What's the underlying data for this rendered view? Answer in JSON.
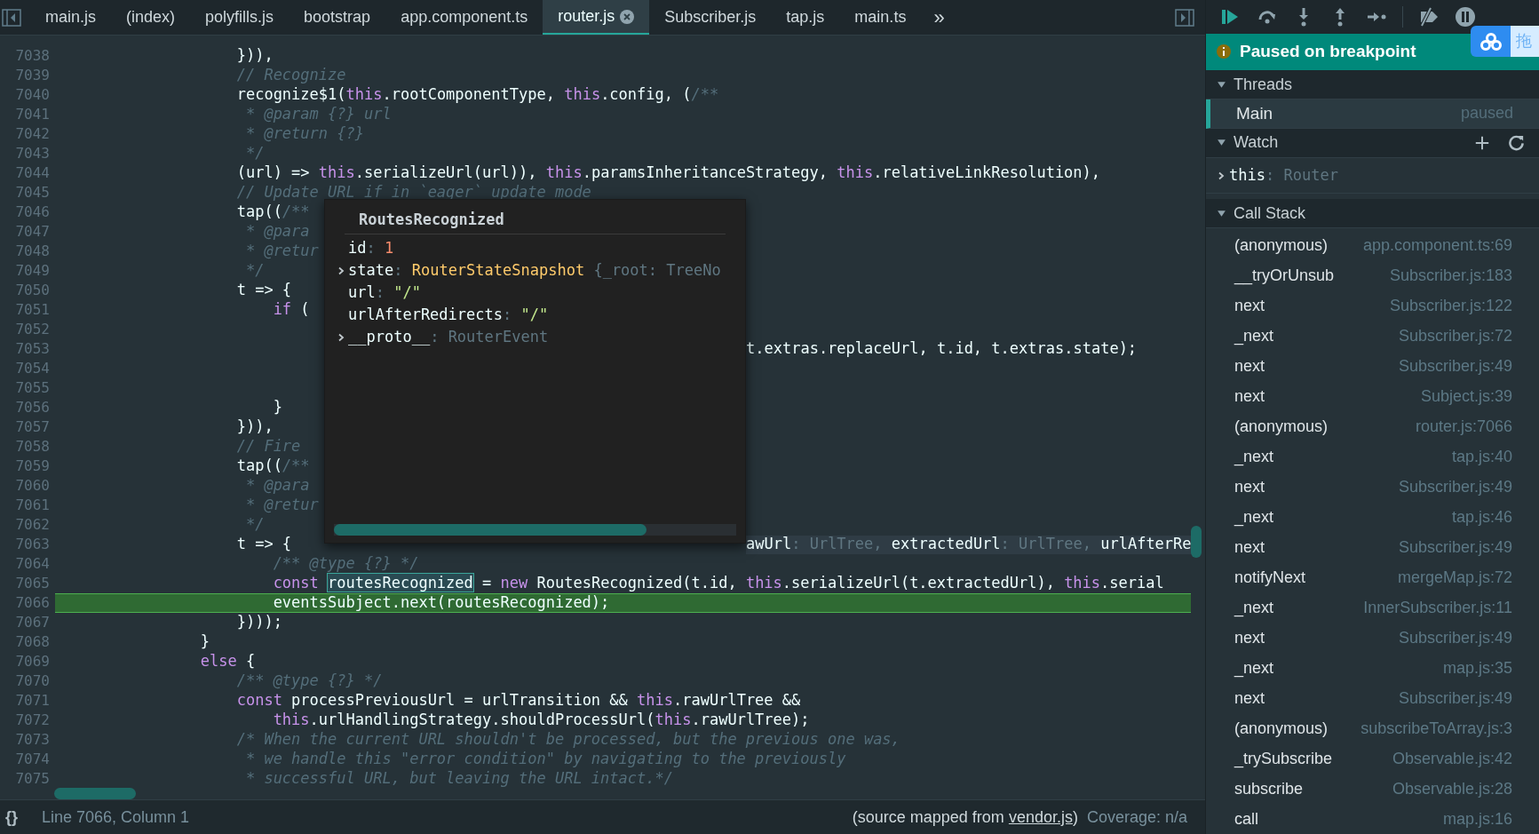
{
  "tabs": [
    {
      "label": "main.js",
      "selected": false
    },
    {
      "label": "(index)",
      "selected": false
    },
    {
      "label": "polyfills.js",
      "selected": false
    },
    {
      "label": "bootstrap",
      "selected": false
    },
    {
      "label": "app.component.ts",
      "selected": false
    },
    {
      "label": "router.js",
      "selected": true
    },
    {
      "label": "Subscriber.js",
      "selected": false
    },
    {
      "label": "tap.js",
      "selected": false
    },
    {
      "label": "main.ts",
      "selected": false
    }
  ],
  "tabs_overflow": "»",
  "editor": {
    "lines": [
      {
        "number": "7038",
        "current": false,
        "tokens": [
          {
            "t": "                    })),",
            "kind": "plain"
          }
        ]
      },
      {
        "number": "7039",
        "current": false,
        "tokens": [
          {
            "t": "                    // Recognize",
            "kind": "comment"
          }
        ]
      },
      {
        "number": "7040",
        "current": false,
        "tokens": [
          {
            "t": "                    recognize$1(",
            "kind": "plain"
          },
          {
            "t": "this",
            "kind": "keyword"
          },
          {
            "t": ".rootComponentType, ",
            "kind": "plain"
          },
          {
            "t": "this",
            "kind": "keyword"
          },
          {
            "t": ".config, (",
            "kind": "plain"
          },
          {
            "t": "/**",
            "kind": "comment"
          }
        ]
      },
      {
        "number": "7041",
        "current": false,
        "tokens": [
          {
            "t": "                     * @param {?} url",
            "kind": "comment"
          }
        ]
      },
      {
        "number": "7042",
        "current": false,
        "tokens": [
          {
            "t": "                     * @return {?}",
            "kind": "comment"
          }
        ]
      },
      {
        "number": "7043",
        "current": false,
        "tokens": [
          {
            "t": "                     */",
            "kind": "comment"
          }
        ]
      },
      {
        "number": "7044",
        "current": false,
        "tokens": [
          {
            "t": "                    (url) => ",
            "kind": "plain"
          },
          {
            "t": "this",
            "kind": "keyword"
          },
          {
            "t": ".serializeUrl(url)), ",
            "kind": "plain"
          },
          {
            "t": "this",
            "kind": "keyword"
          },
          {
            "t": ".paramsInheritanceStrategy, ",
            "kind": "plain"
          },
          {
            "t": "this",
            "kind": "keyword"
          },
          {
            "t": ".relativeLinkResolution),",
            "kind": "plain"
          }
        ]
      },
      {
        "number": "7045",
        "current": false,
        "tokens": [
          {
            "t": "                    // Update URL if in `eager` update mode",
            "kind": "comment"
          }
        ]
      },
      {
        "number": "7046",
        "current": false,
        "tokens": [
          {
            "t": "                    tap((",
            "kind": "plain"
          },
          {
            "t": "/**",
            "kind": "comment"
          }
        ]
      },
      {
        "number": "7047",
        "current": false,
        "tokens": [
          {
            "t": "                     * @para",
            "kind": "comment"
          }
        ]
      },
      {
        "number": "7048",
        "current": false,
        "tokens": [
          {
            "t": "                     * @retur",
            "kind": "comment"
          }
        ]
      },
      {
        "number": "7049",
        "current": false,
        "tokens": [
          {
            "t": "                     */",
            "kind": "comment"
          }
        ]
      },
      {
        "number": "7050",
        "current": false,
        "tokens": [
          {
            "t": "                    t => {",
            "kind": "plain"
          }
        ]
      },
      {
        "number": "7051",
        "current": false,
        "tokens": [
          {
            "t": "                        if",
            "kind": "keyword"
          },
          {
            "t": " (",
            "kind": "plain"
          }
        ]
      },
      {
        "number": "7052",
        "current": false
      },
      {
        "number": "7053",
        "current": false,
        "after": {
          "kind": "code",
          "tokens": [
            {
              "t": "t.extras.replaceUrl, t.id, t.extras.state);",
              "kind": "plain"
            }
          ]
        }
      },
      {
        "number": "7054",
        "current": false
      },
      {
        "number": "7055",
        "current": false
      },
      {
        "number": "7056",
        "current": false,
        "tokens": [
          {
            "t": "                        }",
            "kind": "plain"
          }
        ]
      },
      {
        "number": "7057",
        "current": false,
        "tokens": [
          {
            "t": "                    })),",
            "kind": "plain"
          }
        ]
      },
      {
        "number": "7058",
        "current": false,
        "tokens": [
          {
            "t": "                    // Fire",
            "kind": "comment"
          }
        ]
      },
      {
        "number": "7059",
        "current": false,
        "tokens": [
          {
            "t": "                    tap((",
            "kind": "plain"
          },
          {
            "t": "/**",
            "kind": "comment"
          }
        ]
      },
      {
        "number": "7060",
        "current": false,
        "tokens": [
          {
            "t": "                     * @para",
            "kind": "comment"
          }
        ]
      },
      {
        "number": "7061",
        "current": false,
        "tokens": [
          {
            "t": "                     * @retur",
            "kind": "comment"
          }
        ]
      },
      {
        "number": "7062",
        "current": false,
        "tokens": [
          {
            "t": "                     */",
            "kind": "comment"
          }
        ]
      },
      {
        "number": "7063",
        "current": false,
        "tokens": [
          {
            "t": "                    t => {",
            "kind": "plain"
          }
        ],
        "after": {
          "kind": "inline_values",
          "tokens": [
            {
              "t": "awUrl",
              "kind": "plain"
            },
            {
              "t": ": UrlTree, ",
              "kind": "dim"
            },
            {
              "t": "extractedUrl",
              "kind": "plain"
            },
            {
              "t": ": UrlTree, ",
              "kind": "dim"
            },
            {
              "t": "urlAfterRe",
              "kind": "plain"
            }
          ]
        }
      },
      {
        "number": "7064",
        "current": false,
        "tokens": [
          {
            "t": "                        /** @type {?} */",
            "kind": "comment"
          }
        ]
      },
      {
        "number": "7065",
        "current": false,
        "tokens": [
          {
            "t": "                        const ",
            "kind": "keyword"
          },
          {
            "t": "routesRecognized",
            "kind": "highlight"
          },
          {
            "t": " = ",
            "kind": "plain"
          },
          {
            "t": "new",
            "kind": "keyword"
          },
          {
            "t": " RoutesRecognized(t.id, ",
            "kind": "plain"
          },
          {
            "t": "this",
            "kind": "keyword"
          },
          {
            "t": ".serializeUrl(t.extractedUrl), ",
            "kind": "plain"
          },
          {
            "t": "this",
            "kind": "keyword"
          },
          {
            "t": ".serial",
            "kind": "plain"
          }
        ]
      },
      {
        "number": "7066",
        "current": true,
        "tokens": [
          {
            "t": "                        eventsSubject.next(routesRecognized);",
            "kind": "plain"
          }
        ]
      },
      {
        "number": "7067",
        "current": false,
        "tokens": [
          {
            "t": "                    })));",
            "kind": "plain"
          }
        ]
      },
      {
        "number": "7068",
        "current": false,
        "tokens": [
          {
            "t": "                }",
            "kind": "plain"
          }
        ]
      },
      {
        "number": "7069",
        "current": false,
        "tokens": [
          {
            "t": "                else",
            "kind": "keyword"
          },
          {
            "t": " {",
            "kind": "plain"
          }
        ]
      },
      {
        "number": "7070",
        "current": false,
        "tokens": [
          {
            "t": "                    /** @type {?} */",
            "kind": "comment"
          }
        ]
      },
      {
        "number": "7071",
        "current": false,
        "tokens": [
          {
            "t": "                    const",
            "kind": "keyword"
          },
          {
            "t": " processPreviousUrl = urlTransition && ",
            "kind": "plain"
          },
          {
            "t": "this",
            "kind": "keyword"
          },
          {
            "t": ".rawUrlTree &&",
            "kind": "plain"
          }
        ]
      },
      {
        "number": "7072",
        "current": false,
        "tokens": [
          {
            "t": "                        this",
            "kind": "keyword"
          },
          {
            "t": ".urlHandlingStrategy.shouldProcessUrl(",
            "kind": "plain"
          },
          {
            "t": "this",
            "kind": "keyword"
          },
          {
            "t": ".rawUrlTree);",
            "kind": "plain"
          }
        ]
      },
      {
        "number": "7073",
        "current": false,
        "tokens": [
          {
            "t": "                    /* When the current URL shouldn't be processed, but the previous one was,",
            "kind": "comment"
          }
        ]
      },
      {
        "number": "7074",
        "current": false,
        "tokens": [
          {
            "t": "                     * we handle this \"error condition\" by navigating to the previously",
            "kind": "comment"
          }
        ]
      },
      {
        "number": "7075",
        "current": false,
        "tokens": [
          {
            "t": "                     * successful URL, but leaving the URL intact.*/",
            "kind": "comment"
          }
        ]
      }
    ],
    "popup": {
      "title": "RoutesRecognized",
      "items": [
        {
          "key": "id",
          "sep": ":",
          "kind": "number",
          "value": "1"
        },
        {
          "key": "state",
          "sep": ":",
          "kind": "object",
          "expanded": false,
          "value": "RouterStateSnapshot",
          "preview": "{_root: TreeNo"
        },
        {
          "key": "url",
          "sep": ":",
          "kind": "string",
          "value": "\"/\""
        },
        {
          "key": "urlAfterRedirects",
          "sep": ":",
          "kind": "string",
          "value": "\"/\""
        },
        {
          "key": "__proto__",
          "sep": ":",
          "kind": "proto",
          "expanded": false,
          "value": "RouterEvent"
        }
      ]
    }
  },
  "status_bar": {
    "format_button": "{}",
    "position": "Line 7066, Column 1",
    "source_prefix": "(source mapped from",
    "source_link": "vendor.js",
    "source_suffix": ")",
    "coverage": "Coverage: n/a"
  },
  "debugger": {
    "banner": "Paused on breakpoint",
    "threads": {
      "title": "Threads",
      "expanded": true,
      "items": [
        {
          "name": "Main",
          "status": "paused",
          "selected": true
        }
      ]
    },
    "watch": {
      "title": "Watch",
      "expanded": true,
      "items": [
        {
          "name": "this",
          "sep": ":",
          "value": "Router",
          "expanded": false
        }
      ]
    },
    "call_stack": {
      "title": "Call Stack",
      "expanded": true,
      "frames": [
        {
          "name": "(anonymous)",
          "location": "app.component.ts:69"
        },
        {
          "name": "__tryOrUnsub",
          "location": "Subscriber.js:183"
        },
        {
          "name": "next",
          "location": "Subscriber.js:122"
        },
        {
          "name": "_next",
          "location": "Subscriber.js:72"
        },
        {
          "name": "next",
          "location": "Subscriber.js:49"
        },
        {
          "name": "next",
          "location": "Subject.js:39"
        },
        {
          "name": "(anonymous)",
          "location": "router.js:7066"
        },
        {
          "name": "_next",
          "location": "tap.js:40"
        },
        {
          "name": "next",
          "location": "Subscriber.js:49"
        },
        {
          "name": "_next",
          "location": "tap.js:46"
        },
        {
          "name": "next",
          "location": "Subscriber.js:49"
        },
        {
          "name": "notifyNext",
          "location": "mergeMap.js:72"
        },
        {
          "name": "_next",
          "location": "InnerSubscriber.js:11"
        },
        {
          "name": "next",
          "location": "Subscriber.js:49"
        },
        {
          "name": "_next",
          "location": "map.js:35"
        },
        {
          "name": "next",
          "location": "Subscriber.js:49"
        },
        {
          "name": "(anonymous)",
          "location": "subscribeToArray.js:3"
        },
        {
          "name": "_trySubscribe",
          "location": "Observable.js:42"
        },
        {
          "name": "subscribe",
          "location": "Observable.js:28"
        },
        {
          "name": "call",
          "location": "map.js:16"
        }
      ]
    }
  },
  "overlay": {
    "label": "拖"
  }
}
